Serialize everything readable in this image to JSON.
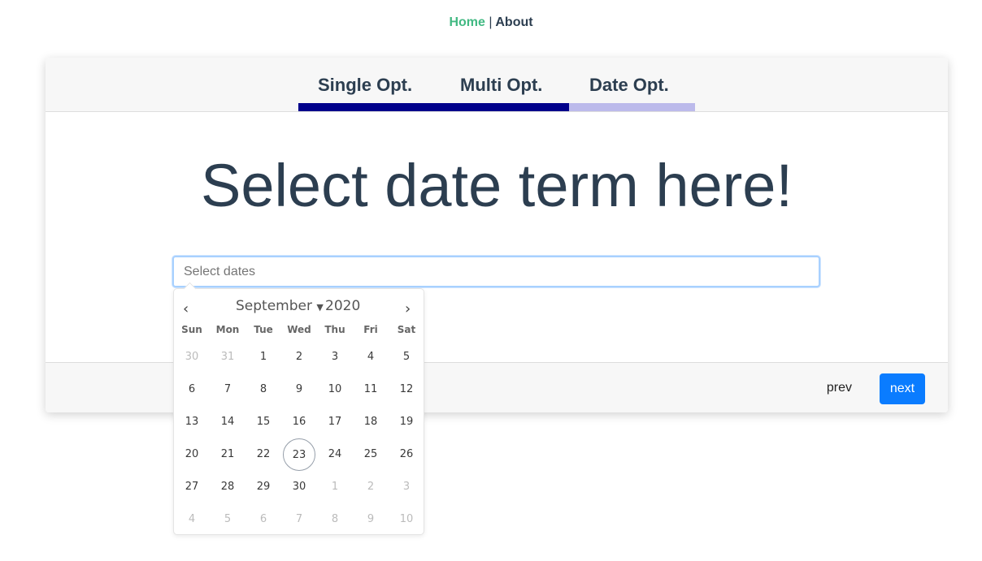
{
  "nav": {
    "home": "Home",
    "sep": "|",
    "about": "About"
  },
  "tabs": [
    {
      "label": "Single Opt."
    },
    {
      "label": "Multi Opt."
    },
    {
      "label": "Date Opt."
    }
  ],
  "progress": {
    "completed_steps": 2,
    "total_steps": 3,
    "done_color": "#00008b",
    "pending_color": "#bcbaeb"
  },
  "main": {
    "title": "Select date term here!",
    "input_placeholder": "Select dates"
  },
  "footer": {
    "prev": "prev",
    "next": "next"
  },
  "calendar": {
    "month": "September",
    "year": "2020",
    "weekdays": [
      "Sun",
      "Mon",
      "Tue",
      "Wed",
      "Thu",
      "Fri",
      "Sat"
    ],
    "weeks": [
      [
        "30",
        "31",
        "1",
        "2",
        "3",
        "4",
        "5"
      ],
      [
        "6",
        "7",
        "8",
        "9",
        "10",
        "11",
        "12"
      ],
      [
        "13",
        "14",
        "15",
        "16",
        "17",
        "18",
        "19"
      ],
      [
        "20",
        "21",
        "22",
        "23",
        "24",
        "25",
        "26"
      ],
      [
        "27",
        "28",
        "29",
        "30",
        "1",
        "2",
        "3"
      ],
      [
        "4",
        "5",
        "6",
        "7",
        "8",
        "9",
        "10"
      ]
    ],
    "today": "23"
  }
}
